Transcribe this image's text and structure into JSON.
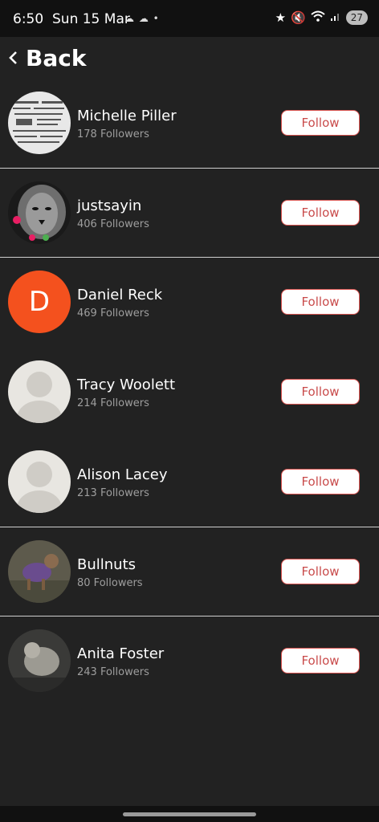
{
  "status_bar": {
    "time": "6:50",
    "date": "Sun 15 Mar",
    "notification_icons": "☁ ☁ •",
    "battery": "27"
  },
  "header": {
    "back_label": "Back"
  },
  "users": [
    {
      "name": "Michelle Piller",
      "followers": "178 Followers",
      "follow_label": "Follow",
      "avatar": "newspaper-photo"
    },
    {
      "name": "justsayin",
      "followers": "406 Followers",
      "follow_label": "Follow",
      "avatar": "lion-photo"
    },
    {
      "name": "Daniel Reck",
      "followers": "469 Followers",
      "follow_label": "Follow",
      "avatar": "initial",
      "initial": "D"
    },
    {
      "name": "Tracy Woolett",
      "followers": "214 Followers",
      "follow_label": "Follow",
      "avatar": "default-silhouette"
    },
    {
      "name": "Alison Lacey",
      "followers": "213 Followers",
      "follow_label": "Follow",
      "avatar": "default-silhouette"
    },
    {
      "name": "Bullnuts",
      "followers": "80 Followers",
      "follow_label": "Follow",
      "avatar": "dog-photo"
    },
    {
      "name": "Anita Foster",
      "followers": "243 Followers",
      "follow_label": "Follow",
      "avatar": "cat-photo"
    }
  ],
  "colors": {
    "background": "#222222",
    "follow_border": "#d9534f",
    "follow_text": "#c94b4b",
    "initial_avatar": "#f4511e"
  }
}
